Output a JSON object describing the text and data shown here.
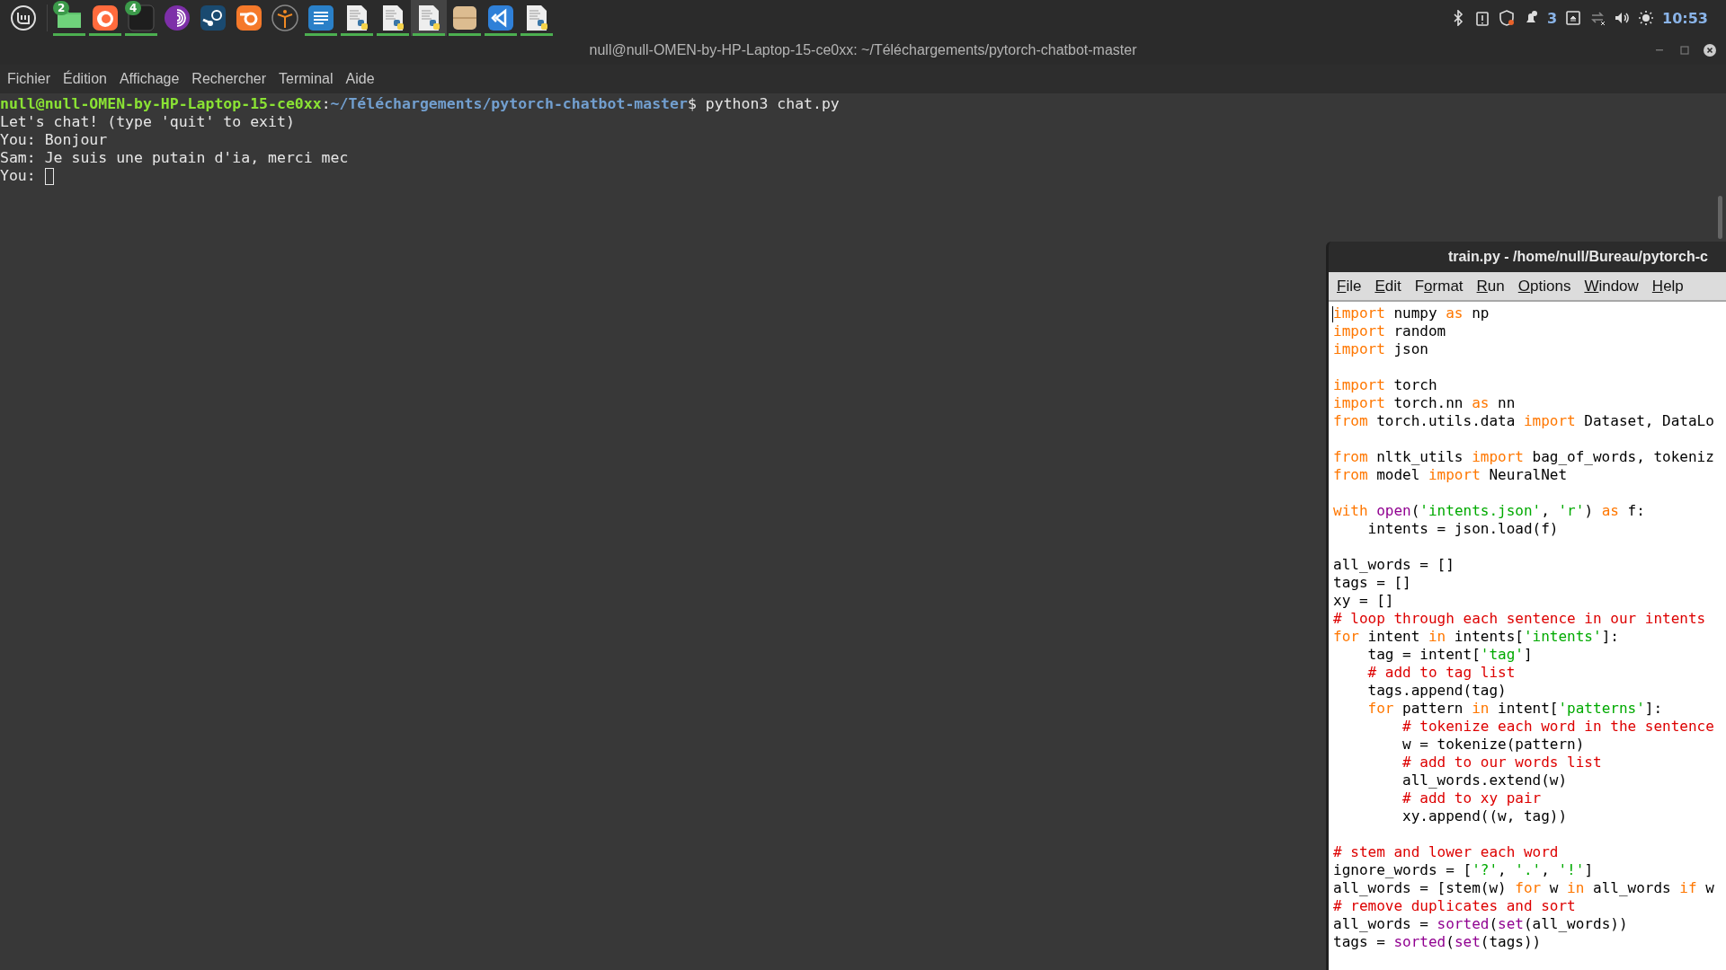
{
  "panel": {
    "launchers": [
      {
        "kind": "files",
        "badge": "2",
        "running": true,
        "selected": false
      },
      {
        "kind": "firefox",
        "running": true,
        "selected": false
      },
      {
        "kind": "terminal",
        "badge": "4",
        "running": true,
        "selected": false
      },
      {
        "kind": "tor",
        "running": false,
        "selected": false
      },
      {
        "kind": "steam",
        "running": false,
        "selected": false
      },
      {
        "kind": "blender",
        "running": false,
        "selected": false
      },
      {
        "kind": "figure",
        "running": false,
        "selected": false
      },
      {
        "kind": "writer",
        "running": true,
        "selected": false
      },
      {
        "kind": "python",
        "running": true,
        "selected": false
      },
      {
        "kind": "python",
        "running": true,
        "selected": false
      },
      {
        "kind": "python",
        "running": true,
        "selected": true
      },
      {
        "kind": "archive",
        "running": true,
        "selected": false
      },
      {
        "kind": "vscode",
        "running": true,
        "selected": false
      },
      {
        "kind": "python",
        "running": true,
        "selected": false
      }
    ],
    "tray": {
      "notification_count": "3",
      "clock": "10:53"
    }
  },
  "terminal": {
    "title": "null@null-OMEN-by-HP-Laptop-15-ce0xx: ~/Téléchargements/pytorch-chatbot-master",
    "menu": [
      "Fichier",
      "Édition",
      "Affichage",
      "Rechercher",
      "Terminal",
      "Aide"
    ],
    "lines": [
      {
        "segments": [
          {
            "kind": "user",
            "text": "null@null-OMEN-by-HP-Laptop-15-ce0xx"
          },
          {
            "kind": "plain",
            "text": ":"
          },
          {
            "kind": "path",
            "text": "~/Téléchargements/pytorch-chatbot-master"
          },
          {
            "kind": "plain",
            "text": "$ python3 chat.py"
          }
        ]
      },
      {
        "segments": [
          {
            "kind": "plain",
            "text": "Let's chat! (type 'quit' to exit)"
          }
        ]
      },
      {
        "segments": [
          {
            "kind": "plain",
            "text": "You: Bonjour"
          }
        ]
      },
      {
        "segments": [
          {
            "kind": "plain",
            "text": "Sam: Je suis une putain d'ia, merci mec"
          }
        ]
      },
      {
        "segments": [
          {
            "kind": "plain",
            "text": "You: "
          }
        ]
      }
    ],
    "cursor": true
  },
  "editor": {
    "title": "train.py - /home/null/Bureau/pytorch-c",
    "menu": [
      {
        "key": "F",
        "after": "ile"
      },
      {
        "key": "E",
        "after": "dit"
      },
      {
        "before": "F",
        "key": "o",
        "after": "rmat"
      },
      {
        "key": "R",
        "after": "un"
      },
      {
        "key": "O",
        "after": "ptions"
      },
      {
        "key": "W",
        "after": "indow"
      },
      {
        "key": "H",
        "after": "elp"
      }
    ],
    "cursor": true,
    "lines": [
      {
        "kind": "code",
        "tokens": [
          {
            "kind": "keyword",
            "text": "import"
          },
          {
            "kind": "plain",
            "text": " numpy "
          },
          {
            "kind": "keyword",
            "text": "as"
          },
          {
            "kind": "plain",
            "text": " np"
          }
        ]
      },
      {
        "kind": "code",
        "tokens": [
          {
            "kind": "keyword",
            "text": "import"
          },
          {
            "kind": "plain",
            "text": " random"
          }
        ]
      },
      {
        "kind": "code",
        "tokens": [
          {
            "kind": "keyword",
            "text": "import"
          },
          {
            "kind": "plain",
            "text": " json"
          }
        ]
      },
      {
        "kind": "blank"
      },
      {
        "kind": "code",
        "tokens": [
          {
            "kind": "keyword",
            "text": "import"
          },
          {
            "kind": "plain",
            "text": " torch"
          }
        ]
      },
      {
        "kind": "code",
        "tokens": [
          {
            "kind": "keyword",
            "text": "import"
          },
          {
            "kind": "plain",
            "text": " torch.nn "
          },
          {
            "kind": "keyword",
            "text": "as"
          },
          {
            "kind": "plain",
            "text": " nn"
          }
        ]
      },
      {
        "kind": "code",
        "tokens": [
          {
            "kind": "keyword",
            "text": "from"
          },
          {
            "kind": "plain",
            "text": " torch.utils.data "
          },
          {
            "kind": "keyword",
            "text": "import"
          },
          {
            "kind": "plain",
            "text": " Dataset, DataLo"
          }
        ]
      },
      {
        "kind": "blank"
      },
      {
        "kind": "code",
        "tokens": [
          {
            "kind": "keyword",
            "text": "from"
          },
          {
            "kind": "plain",
            "text": " nltk_utils "
          },
          {
            "kind": "keyword",
            "text": "import"
          },
          {
            "kind": "plain",
            "text": " bag_of_words, tokeniz"
          }
        ]
      },
      {
        "kind": "code",
        "tokens": [
          {
            "kind": "keyword",
            "text": "from"
          },
          {
            "kind": "plain",
            "text": " model "
          },
          {
            "kind": "keyword",
            "text": "import"
          },
          {
            "kind": "plain",
            "text": " NeuralNet"
          }
        ]
      },
      {
        "kind": "blank"
      },
      {
        "kind": "code",
        "tokens": [
          {
            "kind": "keyword",
            "text": "with"
          },
          {
            "kind": "builtin",
            "text": " open"
          },
          {
            "kind": "plain",
            "text": "("
          },
          {
            "kind": "string",
            "text": "'intents.json'"
          },
          {
            "kind": "plain",
            "text": ", "
          },
          {
            "kind": "string",
            "text": "'r'"
          },
          {
            "kind": "plain",
            "text": ") "
          },
          {
            "kind": "keyword",
            "text": "as"
          },
          {
            "kind": "plain",
            "text": " f:"
          }
        ]
      },
      {
        "kind": "code",
        "tokens": [
          {
            "kind": "plain",
            "text": "    intents = json.load(f)"
          }
        ]
      },
      {
        "kind": "blank"
      },
      {
        "kind": "code",
        "tokens": [
          {
            "kind": "plain",
            "text": "all_words = []"
          }
        ]
      },
      {
        "kind": "code",
        "tokens": [
          {
            "kind": "plain",
            "text": "tags = []"
          }
        ]
      },
      {
        "kind": "code",
        "tokens": [
          {
            "kind": "plain",
            "text": "xy = []"
          }
        ]
      },
      {
        "kind": "code",
        "tokens": [
          {
            "kind": "comment",
            "text": "# loop through each sentence in our intents"
          }
        ]
      },
      {
        "kind": "code",
        "tokens": [
          {
            "kind": "keyword",
            "text": "for"
          },
          {
            "kind": "plain",
            "text": " intent "
          },
          {
            "kind": "keyword",
            "text": "in"
          },
          {
            "kind": "plain",
            "text": " intents["
          },
          {
            "kind": "string",
            "text": "'intents'"
          },
          {
            "kind": "plain",
            "text": "]:"
          }
        ]
      },
      {
        "kind": "code",
        "tokens": [
          {
            "kind": "plain",
            "text": "    tag = intent["
          },
          {
            "kind": "string",
            "text": "'tag'"
          },
          {
            "kind": "plain",
            "text": "]"
          }
        ]
      },
      {
        "kind": "code",
        "tokens": [
          {
            "kind": "comment",
            "text": "    # add to tag list"
          }
        ]
      },
      {
        "kind": "code",
        "tokens": [
          {
            "kind": "plain",
            "text": "    tags.append(tag)"
          }
        ]
      },
      {
        "kind": "code",
        "tokens": [
          {
            "kind": "keyword",
            "text": "    for"
          },
          {
            "kind": "plain",
            "text": " pattern "
          },
          {
            "kind": "keyword",
            "text": "in"
          },
          {
            "kind": "plain",
            "text": " intent["
          },
          {
            "kind": "string",
            "text": "'patterns'"
          },
          {
            "kind": "plain",
            "text": "]:"
          }
        ]
      },
      {
        "kind": "code",
        "tokens": [
          {
            "kind": "comment",
            "text": "        # tokenize each word in the sentence"
          }
        ]
      },
      {
        "kind": "code",
        "tokens": [
          {
            "kind": "plain",
            "text": "        w = tokenize(pattern)"
          }
        ]
      },
      {
        "kind": "code",
        "tokens": [
          {
            "kind": "comment",
            "text": "        # add to our words list"
          }
        ]
      },
      {
        "kind": "code",
        "tokens": [
          {
            "kind": "plain",
            "text": "        all_words.extend(w)"
          }
        ]
      },
      {
        "kind": "code",
        "tokens": [
          {
            "kind": "comment",
            "text": "        # add to xy pair"
          }
        ]
      },
      {
        "kind": "code",
        "tokens": [
          {
            "kind": "plain",
            "text": "        xy.append((w, tag))"
          }
        ]
      },
      {
        "kind": "blank"
      },
      {
        "kind": "code",
        "tokens": [
          {
            "kind": "comment",
            "text": "# stem and lower each word"
          }
        ]
      },
      {
        "kind": "code",
        "tokens": [
          {
            "kind": "plain",
            "text": "ignore_words = ["
          },
          {
            "kind": "string",
            "text": "'?'"
          },
          {
            "kind": "plain",
            "text": ", "
          },
          {
            "kind": "string",
            "text": "'.'"
          },
          {
            "kind": "plain",
            "text": ", "
          },
          {
            "kind": "string",
            "text": "'!'"
          },
          {
            "kind": "plain",
            "text": "]"
          }
        ]
      },
      {
        "kind": "code",
        "tokens": [
          {
            "kind": "plain",
            "text": "all_words = [stem(w) "
          },
          {
            "kind": "keyword",
            "text": "for"
          },
          {
            "kind": "plain",
            "text": " w "
          },
          {
            "kind": "keyword",
            "text": "in"
          },
          {
            "kind": "plain",
            "text": " all_words "
          },
          {
            "kind": "keyword",
            "text": "if"
          },
          {
            "kind": "plain",
            "text": " w"
          }
        ]
      },
      {
        "kind": "code",
        "tokens": [
          {
            "kind": "comment",
            "text": "# remove duplicates and sort"
          }
        ]
      },
      {
        "kind": "code",
        "tokens": [
          {
            "kind": "plain",
            "text": "all_words = "
          },
          {
            "kind": "builtin",
            "text": "sorted"
          },
          {
            "kind": "plain",
            "text": "("
          },
          {
            "kind": "builtin",
            "text": "set"
          },
          {
            "kind": "plain",
            "text": "(all_words))"
          }
        ]
      },
      {
        "kind": "code",
        "tokens": [
          {
            "kind": "plain",
            "text": "tags = "
          },
          {
            "kind": "builtin",
            "text": "sorted"
          },
          {
            "kind": "plain",
            "text": "("
          },
          {
            "kind": "builtin",
            "text": "set"
          },
          {
            "kind": "plain",
            "text": "(tags))"
          }
        ]
      }
    ]
  }
}
